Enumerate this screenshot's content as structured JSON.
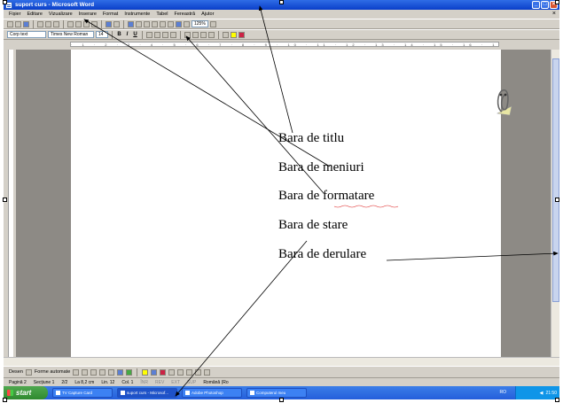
{
  "window": {
    "title": "suport curs - Microsoft Word",
    "menu": [
      "Fișier",
      "Editare",
      "Vizualizare",
      "Inserare",
      "Format",
      "Instrumente",
      "Tabel",
      "Fereastră",
      "Ajutor"
    ]
  },
  "standard_toolbar": {
    "zoom": "125%"
  },
  "formatting_toolbar": {
    "style": "Corp text",
    "font": "Times New Roman",
    "size": "14"
  },
  "ruler": {
    "scale": "· 1 · 2 · 3 · 4 · 5 · 6 · 7 · 8 · 9 · 10 · 11 · 12 · 13 · 14 · 15 · 16 · 17 · 18"
  },
  "labels": [
    "Bara de titlu",
    "Bara de meniuri",
    "Bara de formatare",
    "Bara de stare",
    "Bara de derulare"
  ],
  "drawing_toolbar": {
    "draw": "Desen",
    "autoshapes": "Forme automate"
  },
  "status": {
    "page": "Pagină 2",
    "section": "Secțiune 1",
    "pages": "2/2",
    "position": "La 8,2 cm",
    "line": "Lin. 12",
    "col": "Col. 1",
    "modes": [
      "ÎNR",
      "REV",
      "EXT",
      "SUP"
    ],
    "language": "Română (Ro"
  },
  "taskbar": {
    "start": "start",
    "tasks": [
      "TV Capture Card",
      "suport curs - Microsof...",
      "Adobe Photoshop",
      "Computerul meu"
    ],
    "lang": "RO",
    "clock": "21:50"
  },
  "colors": {
    "title_blue": "#0a3fc9",
    "taskbar_blue": "#245edb",
    "start_green": "#2f8a2f",
    "chrome": "#d4d0c8"
  },
  "icons": [
    "word-app-icon",
    "minimize-icon",
    "maximize-icon",
    "close-icon",
    "new-icon",
    "open-icon",
    "save-icon",
    "print-icon",
    "undo-icon",
    "redo-icon",
    "bold-icon",
    "italic-icon",
    "underline-icon",
    "office-assistant-icon",
    "windows-flag-icon"
  ]
}
